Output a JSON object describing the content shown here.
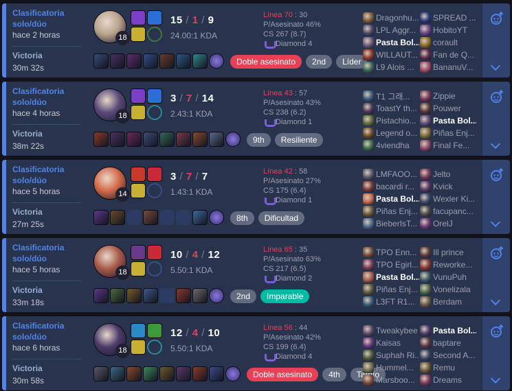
{
  "matches": [
    {
      "queue": "Clasificatoria solo/dúo",
      "ago": "hace 2 horas",
      "result": "Victoria",
      "duration": "30m 32s",
      "level": "18",
      "kills": "15",
      "deaths": "1",
      "assists": "9",
      "ratio": "24.00:1 KDA",
      "lane_label": "Línea 70",
      "lane_rest": " : 30",
      "kp": "P/Asesinato 46%",
      "cs": "CS 267 (8.7)",
      "rank": "Diamond 4",
      "champ_color": "#b8a48e",
      "spells": [
        "#7b3fc6",
        "#2a6fd6"
      ],
      "runes": [
        "#c8b035",
        "#3e7a3a"
      ],
      "items": [
        "#3a4c7a",
        "#4a3162",
        "#5f2e6e",
        "#31508a",
        "#6a3f2c",
        "#2a5a86",
        "#2e8a8e"
      ],
      "badges": [
        {
          "t": "Doble asesinato",
          "c": "red"
        },
        {
          "t": "2nd",
          "c": ""
        },
        {
          "t": "Líder",
          "c": ""
        }
      ],
      "blue": [
        {
          "n": "Dragonhu...",
          "c": "#7a5a3a"
        },
        {
          "n": "LPL Aggr...",
          "c": "#4a4a6a"
        },
        {
          "n": "Pasta Bol...",
          "c": "#6b5a7b",
          "me": true
        },
        {
          "n": "WILLAUT...",
          "c": "#8a3a2a"
        },
        {
          "n": "L9 Alois ...",
          "c": "#3a6a5a"
        }
      ],
      "red": [
        {
          "n": "SPREAD ...",
          "c": "#2a3a7a"
        },
        {
          "n": "HobitoYT",
          "c": "#6a4a8a"
        },
        {
          "n": "corault",
          "c": "#8a6a2a"
        },
        {
          "n": "Fan de Q...",
          "c": "#5a2a4a"
        },
        {
          "n": "BananuV...",
          "c": "#a04a6a"
        }
      ]
    },
    {
      "queue": "Clasificatoria solo/dúo",
      "ago": "hace 4 horas",
      "result": "Victoria",
      "duration": "38m 22s",
      "level": "18",
      "kills": "3",
      "deaths": "7",
      "assists": "14",
      "ratio": "2.43:1 KDA",
      "lane_label": "Línea 43",
      "lane_rest": " : 57",
      "kp": "P/Asesinato 43%",
      "cs": "CS 238 (6.2)",
      "rank": "Diamond 1",
      "champ_color": "#5a4a7a",
      "spells": [
        "#7b3fc6",
        "#2a6fd6"
      ],
      "runes": [
        "#c8b035",
        "#2e8a8e"
      ],
      "items": [
        "#8a3a2a",
        "#4a3162",
        "#6a2a5a",
        "#3a4c7a",
        "#2e6a5a",
        "#7a3a4a",
        "#8a4a2a",
        "#5a6a8a"
      ],
      "badges": [
        {
          "t": "9th",
          "c": ""
        },
        {
          "t": "Resiliente",
          "c": ""
        }
      ],
      "blue": [
        {
          "n": "T1 그래...",
          "c": "#3a5a7a"
        },
        {
          "n": "ToastY th...",
          "c": "#4a3a5a"
        },
        {
          "n": "Pistachio...",
          "c": "#5a6a3a"
        },
        {
          "n": "Legend o...",
          "c": "#6a4a2a"
        },
        {
          "n": "4viendha",
          "c": "#3a6a4a"
        }
      ],
      "red": [
        {
          "n": "Zippie",
          "c": "#7a3a5a"
        },
        {
          "n": "Pouwer",
          "c": "#5a3a3a"
        },
        {
          "n": "Pasta Bol...",
          "c": "#5a4a7a",
          "me": true
        },
        {
          "n": "Piñas Enj...",
          "c": "#7a6a3a"
        },
        {
          "n": "Final Fe...",
          "c": "#8a4a6a"
        }
      ]
    },
    {
      "queue": "Clasificatoria solo/dúo",
      "ago": "hace 5 horas",
      "result": "Victoria",
      "duration": "27m 25s",
      "level": "14",
      "kills": "3",
      "deaths": "7",
      "assists": "7",
      "ratio": "1.43:1 KDA",
      "lane_label": "Línea 42",
      "lane_rest": " : 58",
      "kp": "P/Asesinato 27%",
      "cs": "CS 175 (6.4)",
      "rank": "Diamond 1",
      "champ_color": "#d46a4a",
      "spells": [
        "#c83a2a",
        "#c82a3a"
      ],
      "runes": [
        "#c8b035",
        "#3a4c8a"
      ],
      "items": [
        "#5a3a8a",
        "#6a4a2a",
        "empty",
        "#7a4a3a",
        "empty",
        "empty",
        "#3a6a9a"
      ],
      "badges": [
        {
          "t": "8th",
          "c": ""
        },
        {
          "t": "Dificultad",
          "c": ""
        }
      ],
      "blue": [
        {
          "n": "LMFAOO...",
          "c": "#5a5a6a"
        },
        {
          "n": "bacardi r...",
          "c": "#7a3a3a"
        },
        {
          "n": "Pasta Bol...",
          "c": "#c46a4a",
          "me": true
        },
        {
          "n": "Piñas Enj...",
          "c": "#6a5a3a"
        },
        {
          "n": "BieberIsT...",
          "c": "#4a6a8a"
        }
      ],
      "red": [
        {
          "n": "Jelto",
          "c": "#7a3a5a"
        },
        {
          "n": "Kvick",
          "c": "#5a3a6a"
        },
        {
          "n": "Wexler Ki...",
          "c": "#3a4a6a"
        },
        {
          "n": "facupanc...",
          "c": "#4a4a4a"
        },
        {
          "n": "OrelJ",
          "c": "#6a3a7a"
        }
      ]
    },
    {
      "queue": "Clasificatoria solo/dúo",
      "ago": "hace 5 horas",
      "result": "Victoria",
      "duration": "33m 18s",
      "level": "18",
      "kills": "10",
      "deaths": "4",
      "assists": "12",
      "ratio": "5.50:1 KDA",
      "lane_label": "Línea 65",
      "lane_rest": " : 35",
      "kp": "P/Asesinato 63%",
      "cs": "CS 217 (6.5)",
      "rank": "Diamond 2",
      "champ_color": "#a85a4a",
      "spells": [
        "#6a3a8a",
        "#c82a3a"
      ],
      "runes": [
        "#c8b035",
        "#3a4c8a"
      ],
      "items": [
        "#5a3a8a",
        "#4a6a3a",
        "#7a5a2a",
        "#3a5a8a",
        "empty",
        "#8a3a2a",
        "#6a6a6a"
      ],
      "badges": [
        {
          "t": "2nd",
          "c": ""
        },
        {
          "t": "Imparable",
          "c": "green"
        }
      ],
      "blue": [
        {
          "n": "TPO Enn...",
          "c": "#6a4a3a"
        },
        {
          "n": "TPO Egirl...",
          "c": "#7a3a5a"
        },
        {
          "n": "Pasta Bol...",
          "c": "#a85a4a",
          "me": true
        },
        {
          "n": "Piñas Enj...",
          "c": "#5a5a3a"
        },
        {
          "n": "L3FT R1...",
          "c": "#3a5a7a"
        }
      ],
      "red": [
        {
          "n": "Ill prince",
          "c": "#5a3a3a"
        },
        {
          "n": "Reworke...",
          "c": "#8a3a3a"
        },
        {
          "n": "VunuPuh",
          "c": "#3a5a6a"
        },
        {
          "n": "Vonelizala",
          "c": "#4a6a4a"
        },
        {
          "n": "Berdam",
          "c": "#6a5a4a"
        }
      ]
    },
    {
      "queue": "Clasificatoria solo/dúo",
      "ago": "hace 6 horas",
      "result": "Victoria",
      "duration": "30m 58s",
      "level": "18",
      "kills": "12",
      "deaths": "4",
      "assists": "10",
      "ratio": "5.50:1 KDA",
      "lane_label": "Línea 56",
      "lane_rest": " : 44",
      "kp": "P/Asesinato 42%",
      "cs": "CS 199 (6.4)",
      "rank": "Diamond 4",
      "champ_color": "#4a3a6a",
      "spells": [
        "#2a8ac6",
        "#3a9a3a"
      ],
      "runes": [
        "#c8b035",
        "#2e8a8e"
      ],
      "items": [
        "#5a5a6a",
        "#3a6a8a",
        "#8a4a2a",
        "#3a8a5a",
        "#6a5a2a",
        "#5a3a6a",
        "#8a3a2a",
        "#3a4c8a"
      ],
      "badges": [
        {
          "t": "Doble asesinato",
          "c": "red"
        },
        {
          "t": "4th",
          "c": ""
        },
        {
          "t": "Tardío",
          "c": ""
        }
      ],
      "blue": [
        {
          "n": "Tweakybee",
          "c": "#5a4a6a"
        },
        {
          "n": "Kaisas",
          "c": "#6a3a7a"
        },
        {
          "n": "Suphah Ri...",
          "c": "#4a5a3a"
        },
        {
          "n": "Hummel...",
          "c": "#6a6a4a"
        },
        {
          "n": "Marsboo...",
          "c": "#7a4a3a"
        }
      ],
      "red": [
        {
          "n": "Pasta Bol...",
          "c": "#4a3a6a",
          "me": true
        },
        {
          "n": "baptare",
          "c": "#5a3a4a"
        },
        {
          "n": "Second A...",
          "c": "#3a4a6a"
        },
        {
          "n": "Remu",
          "c": "#6a5a3a"
        },
        {
          "n": "Dreams",
          "c": "#7a3a5a"
        }
      ]
    }
  ]
}
